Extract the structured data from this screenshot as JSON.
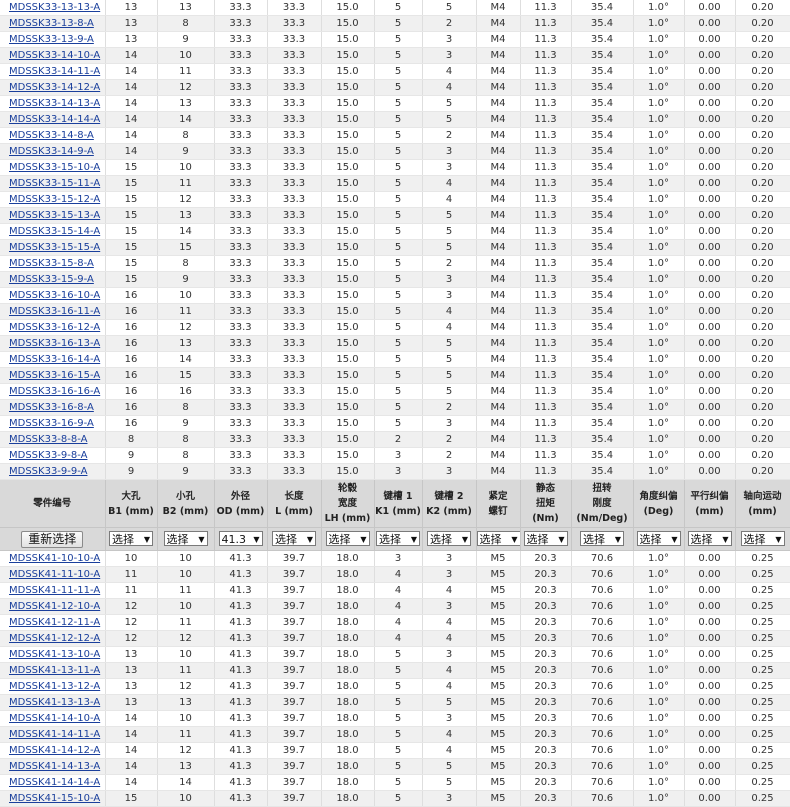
{
  "table1_rows": [
    [
      "MDSSK33-13-13-A",
      "13",
      "13",
      "33.3",
      "33.3",
      "15.0",
      "5",
      "5",
      "M4",
      "11.3",
      "35.4",
      "1.0°",
      "0.00",
      "0.20"
    ],
    [
      "MDSSK33-13-8-A",
      "13",
      "8",
      "33.3",
      "33.3",
      "15.0",
      "5",
      "2",
      "M4",
      "11.3",
      "35.4",
      "1.0°",
      "0.00",
      "0.20"
    ],
    [
      "MDSSK33-13-9-A",
      "13",
      "9",
      "33.3",
      "33.3",
      "15.0",
      "5",
      "3",
      "M4",
      "11.3",
      "35.4",
      "1.0°",
      "0.00",
      "0.20"
    ],
    [
      "MDSSK33-14-10-A",
      "14",
      "10",
      "33.3",
      "33.3",
      "15.0",
      "5",
      "3",
      "M4",
      "11.3",
      "35.4",
      "1.0°",
      "0.00",
      "0.20"
    ],
    [
      "MDSSK33-14-11-A",
      "14",
      "11",
      "33.3",
      "33.3",
      "15.0",
      "5",
      "4",
      "M4",
      "11.3",
      "35.4",
      "1.0°",
      "0.00",
      "0.20"
    ],
    [
      "MDSSK33-14-12-A",
      "14",
      "12",
      "33.3",
      "33.3",
      "15.0",
      "5",
      "4",
      "M4",
      "11.3",
      "35.4",
      "1.0°",
      "0.00",
      "0.20"
    ],
    [
      "MDSSK33-14-13-A",
      "14",
      "13",
      "33.3",
      "33.3",
      "15.0",
      "5",
      "5",
      "M4",
      "11.3",
      "35.4",
      "1.0°",
      "0.00",
      "0.20"
    ],
    [
      "MDSSK33-14-14-A",
      "14",
      "14",
      "33.3",
      "33.3",
      "15.0",
      "5",
      "5",
      "M4",
      "11.3",
      "35.4",
      "1.0°",
      "0.00",
      "0.20"
    ],
    [
      "MDSSK33-14-8-A",
      "14",
      "8",
      "33.3",
      "33.3",
      "15.0",
      "5",
      "2",
      "M4",
      "11.3",
      "35.4",
      "1.0°",
      "0.00",
      "0.20"
    ],
    [
      "MDSSK33-14-9-A",
      "14",
      "9",
      "33.3",
      "33.3",
      "15.0",
      "5",
      "3",
      "M4",
      "11.3",
      "35.4",
      "1.0°",
      "0.00",
      "0.20"
    ],
    [
      "MDSSK33-15-10-A",
      "15",
      "10",
      "33.3",
      "33.3",
      "15.0",
      "5",
      "3",
      "M4",
      "11.3",
      "35.4",
      "1.0°",
      "0.00",
      "0.20"
    ],
    [
      "MDSSK33-15-11-A",
      "15",
      "11",
      "33.3",
      "33.3",
      "15.0",
      "5",
      "4",
      "M4",
      "11.3",
      "35.4",
      "1.0°",
      "0.00",
      "0.20"
    ],
    [
      "MDSSK33-15-12-A",
      "15",
      "12",
      "33.3",
      "33.3",
      "15.0",
      "5",
      "4",
      "M4",
      "11.3",
      "35.4",
      "1.0°",
      "0.00",
      "0.20"
    ],
    [
      "MDSSK33-15-13-A",
      "15",
      "13",
      "33.3",
      "33.3",
      "15.0",
      "5",
      "5",
      "M4",
      "11.3",
      "35.4",
      "1.0°",
      "0.00",
      "0.20"
    ],
    [
      "MDSSK33-15-14-A",
      "15",
      "14",
      "33.3",
      "33.3",
      "15.0",
      "5",
      "5",
      "M4",
      "11.3",
      "35.4",
      "1.0°",
      "0.00",
      "0.20"
    ],
    [
      "MDSSK33-15-15-A",
      "15",
      "15",
      "33.3",
      "33.3",
      "15.0",
      "5",
      "5",
      "M4",
      "11.3",
      "35.4",
      "1.0°",
      "0.00",
      "0.20"
    ],
    [
      "MDSSK33-15-8-A",
      "15",
      "8",
      "33.3",
      "33.3",
      "15.0",
      "5",
      "2",
      "M4",
      "11.3",
      "35.4",
      "1.0°",
      "0.00",
      "0.20"
    ],
    [
      "MDSSK33-15-9-A",
      "15",
      "9",
      "33.3",
      "33.3",
      "15.0",
      "5",
      "3",
      "M4",
      "11.3",
      "35.4",
      "1.0°",
      "0.00",
      "0.20"
    ],
    [
      "MDSSK33-16-10-A",
      "16",
      "10",
      "33.3",
      "33.3",
      "15.0",
      "5",
      "3",
      "M4",
      "11.3",
      "35.4",
      "1.0°",
      "0.00",
      "0.20"
    ],
    [
      "MDSSK33-16-11-A",
      "16",
      "11",
      "33.3",
      "33.3",
      "15.0",
      "5",
      "4",
      "M4",
      "11.3",
      "35.4",
      "1.0°",
      "0.00",
      "0.20"
    ],
    [
      "MDSSK33-16-12-A",
      "16",
      "12",
      "33.3",
      "33.3",
      "15.0",
      "5",
      "4",
      "M4",
      "11.3",
      "35.4",
      "1.0°",
      "0.00",
      "0.20"
    ],
    [
      "MDSSK33-16-13-A",
      "16",
      "13",
      "33.3",
      "33.3",
      "15.0",
      "5",
      "5",
      "M4",
      "11.3",
      "35.4",
      "1.0°",
      "0.00",
      "0.20"
    ],
    [
      "MDSSK33-16-14-A",
      "16",
      "14",
      "33.3",
      "33.3",
      "15.0",
      "5",
      "5",
      "M4",
      "11.3",
      "35.4",
      "1.0°",
      "0.00",
      "0.20"
    ],
    [
      "MDSSK33-16-15-A",
      "16",
      "15",
      "33.3",
      "33.3",
      "15.0",
      "5",
      "5",
      "M4",
      "11.3",
      "35.4",
      "1.0°",
      "0.00",
      "0.20"
    ],
    [
      "MDSSK33-16-16-A",
      "16",
      "16",
      "33.3",
      "33.3",
      "15.0",
      "5",
      "5",
      "M4",
      "11.3",
      "35.4",
      "1.0°",
      "0.00",
      "0.20"
    ],
    [
      "MDSSK33-16-8-A",
      "16",
      "8",
      "33.3",
      "33.3",
      "15.0",
      "5",
      "2",
      "M4",
      "11.3",
      "35.4",
      "1.0°",
      "0.00",
      "0.20"
    ],
    [
      "MDSSK33-16-9-A",
      "16",
      "9",
      "33.3",
      "33.3",
      "15.0",
      "5",
      "3",
      "M4",
      "11.3",
      "35.4",
      "1.0°",
      "0.00",
      "0.20"
    ],
    [
      "MDSSK33-8-8-A",
      "8",
      "8",
      "33.3",
      "33.3",
      "15.0",
      "2",
      "2",
      "M4",
      "11.3",
      "35.4",
      "1.0°",
      "0.00",
      "0.20"
    ],
    [
      "MDSSK33-9-8-A",
      "9",
      "8",
      "33.3",
      "33.3",
      "15.0",
      "3",
      "2",
      "M4",
      "11.3",
      "35.4",
      "1.0°",
      "0.00",
      "0.20"
    ],
    [
      "MDSSK33-9-9-A",
      "9",
      "9",
      "33.3",
      "33.3",
      "15.0",
      "3",
      "3",
      "M4",
      "11.3",
      "35.4",
      "1.0°",
      "0.00",
      "0.20"
    ]
  ],
  "headers": [
    [
      "零件编号"
    ],
    [
      "大孔",
      "B1 (mm)"
    ],
    [
      "小孔",
      "B2 (mm)"
    ],
    [
      "外径",
      "OD (mm)"
    ],
    [
      "长度",
      "L (mm)"
    ],
    [
      "轮毂",
      "宽度",
      "LH (mm)"
    ],
    [
      "键槽 1",
      "K1 (mm)"
    ],
    [
      "键槽 2",
      "K2 (mm)"
    ],
    [
      "紧定",
      "螺钉"
    ],
    [
      "静态",
      "扭矩",
      "(Nm)"
    ],
    [
      "扭转",
      "刚度",
      "(Nm/Deg)"
    ],
    [
      "角度纠偏",
      "(Deg)"
    ],
    [
      "平行纠偏",
      "(mm)"
    ],
    [
      "轴向运动",
      "(mm)"
    ]
  ],
  "controls": {
    "reset_label": "重新选择",
    "filters": [
      "选择",
      "选择",
      "41.3",
      "选择",
      "选择",
      "选择",
      "选择",
      "选择",
      "选择",
      "选择",
      "选择",
      "选择",
      "选择"
    ],
    "dropdown_arrow": "▼"
  },
  "table2_rows": [
    [
      "MDSSK41-10-10-A",
      "10",
      "10",
      "41.3",
      "39.7",
      "18.0",
      "3",
      "3",
      "M5",
      "20.3",
      "70.6",
      "1.0°",
      "0.00",
      "0.25"
    ],
    [
      "MDSSK41-11-10-A",
      "11",
      "10",
      "41.3",
      "39.7",
      "18.0",
      "4",
      "3",
      "M5",
      "20.3",
      "70.6",
      "1.0°",
      "0.00",
      "0.25"
    ],
    [
      "MDSSK41-11-11-A",
      "11",
      "11",
      "41.3",
      "39.7",
      "18.0",
      "4",
      "4",
      "M5",
      "20.3",
      "70.6",
      "1.0°",
      "0.00",
      "0.25"
    ],
    [
      "MDSSK41-12-10-A",
      "12",
      "10",
      "41.3",
      "39.7",
      "18.0",
      "4",
      "3",
      "M5",
      "20.3",
      "70.6",
      "1.0°",
      "0.00",
      "0.25"
    ],
    [
      "MDSSK41-12-11-A",
      "12",
      "11",
      "41.3",
      "39.7",
      "18.0",
      "4",
      "4",
      "M5",
      "20.3",
      "70.6",
      "1.0°",
      "0.00",
      "0.25"
    ],
    [
      "MDSSK41-12-12-A",
      "12",
      "12",
      "41.3",
      "39.7",
      "18.0",
      "4",
      "4",
      "M5",
      "20.3",
      "70.6",
      "1.0°",
      "0.00",
      "0.25"
    ],
    [
      "MDSSK41-13-10-A",
      "13",
      "10",
      "41.3",
      "39.7",
      "18.0",
      "5",
      "3",
      "M5",
      "20.3",
      "70.6",
      "1.0°",
      "0.00",
      "0.25"
    ],
    [
      "MDSSK41-13-11-A",
      "13",
      "11",
      "41.3",
      "39.7",
      "18.0",
      "5",
      "4",
      "M5",
      "20.3",
      "70.6",
      "1.0°",
      "0.00",
      "0.25"
    ],
    [
      "MDSSK41-13-12-A",
      "13",
      "12",
      "41.3",
      "39.7",
      "18.0",
      "5",
      "4",
      "M5",
      "20.3",
      "70.6",
      "1.0°",
      "0.00",
      "0.25"
    ],
    [
      "MDSSK41-13-13-A",
      "13",
      "13",
      "41.3",
      "39.7",
      "18.0",
      "5",
      "5",
      "M5",
      "20.3",
      "70.6",
      "1.0°",
      "0.00",
      "0.25"
    ],
    [
      "MDSSK41-14-10-A",
      "14",
      "10",
      "41.3",
      "39.7",
      "18.0",
      "5",
      "3",
      "M5",
      "20.3",
      "70.6",
      "1.0°",
      "0.00",
      "0.25"
    ],
    [
      "MDSSK41-14-11-A",
      "14",
      "11",
      "41.3",
      "39.7",
      "18.0",
      "5",
      "4",
      "M5",
      "20.3",
      "70.6",
      "1.0°",
      "0.00",
      "0.25"
    ],
    [
      "MDSSK41-14-12-A",
      "14",
      "12",
      "41.3",
      "39.7",
      "18.0",
      "5",
      "4",
      "M5",
      "20.3",
      "70.6",
      "1.0°",
      "0.00",
      "0.25"
    ],
    [
      "MDSSK41-14-13-A",
      "14",
      "13",
      "41.3",
      "39.7",
      "18.0",
      "5",
      "5",
      "M5",
      "20.3",
      "70.6",
      "1.0°",
      "0.00",
      "0.25"
    ],
    [
      "MDSSK41-14-14-A",
      "14",
      "14",
      "41.3",
      "39.7",
      "18.0",
      "5",
      "5",
      "M5",
      "20.3",
      "70.6",
      "1.0°",
      "0.00",
      "0.25"
    ],
    [
      "MDSSK41-15-10-A",
      "15",
      "10",
      "41.3",
      "39.7",
      "18.0",
      "5",
      "3",
      "M5",
      "20.3",
      "70.6",
      "1.0°",
      "0.00",
      "0.25"
    ]
  ]
}
